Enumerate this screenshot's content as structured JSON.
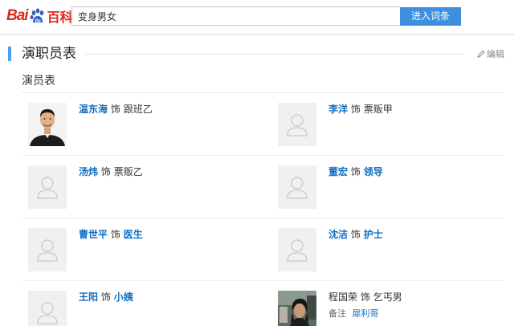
{
  "header": {
    "logo_bai": "Bai",
    "logo_baike": "百科",
    "search_value": "变身男女",
    "enter_button": "进入词条"
  },
  "section": {
    "title": "演职员表",
    "edit_label": "编辑"
  },
  "subtitle": "演员表",
  "cast": [
    {
      "actor": "温东海",
      "sep": "饰",
      "role": "跟班乙",
      "role_is_link": false,
      "actor_is_link": true,
      "photo": "real-photo-man"
    },
    {
      "actor": "李洋",
      "sep": "饰",
      "role": "票贩甲",
      "role_is_link": false,
      "actor_is_link": true,
      "photo": "placeholder"
    },
    {
      "actor": "汤炜",
      "sep": "饰",
      "role": "票贩乙",
      "role_is_link": false,
      "actor_is_link": true,
      "photo": "placeholder"
    },
    {
      "actor": "董宏",
      "sep": "饰",
      "role": "领导",
      "role_is_link": true,
      "actor_is_link": true,
      "photo": "placeholder"
    },
    {
      "actor": "曹世平",
      "sep": "饰",
      "role": "医生",
      "role_is_link": true,
      "actor_is_link": true,
      "photo": "placeholder"
    },
    {
      "actor": "沈洁",
      "sep": "饰",
      "role": "护士",
      "role_is_link": true,
      "actor_is_link": true,
      "photo": "placeholder"
    },
    {
      "actor": "王阳",
      "sep": "饰",
      "role": "小姨",
      "role_is_link": true,
      "actor_is_link": true,
      "photo": "placeholder"
    },
    {
      "actor": "程国荣",
      "sep": "饰",
      "role": "乞丐男",
      "role_is_link": false,
      "actor_is_link": false,
      "photo": "real-photo-street",
      "note_label": "备注",
      "note_value": "犀利哥"
    }
  ],
  "colors": {
    "brand_red": "#e1251b",
    "link_blue": "#136ec2",
    "button_blue": "#3d8fe0",
    "accent_bar": "#4f9cee"
  }
}
